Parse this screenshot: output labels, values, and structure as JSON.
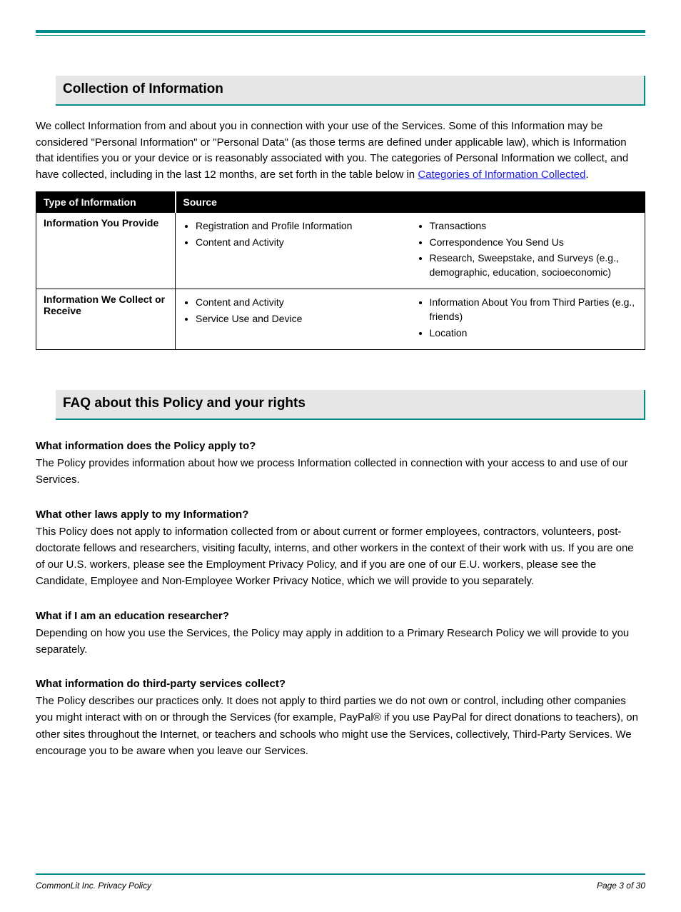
{
  "header_break_label": "Manual Header",
  "section1": {
    "title": "Collection of Information",
    "intro_prefix": "We collect Information from and about you in connection with your use of the Services. Some of this Information may be considered \"Personal Information\" or \"Personal Data\" (as those terms are defined under applicable law), which is Information that identifies you or your device or is reasonably associated with you. The categories of Personal Information we collect, and have collected, including in the last 12 months, are set forth in the table below in ",
    "intro_link": "Categories of Information Collected",
    "table": {
      "h1": "Type of Information",
      "h2": "Source",
      "rows": [
        {
          "category": "Information You Provide",
          "items_left": [
            "Registration and Profile Information",
            "Content and Activity"
          ],
          "items_right": [
            "Transactions",
            "Correspondence You Send Us",
            "Research, Sweepstake, and Surveys (e.g., demographic, education, socioeconomic)"
          ]
        },
        {
          "category": "Information We Collect or Receive",
          "items_left": [
            "Content and Activity",
            "Service Use and Device"
          ],
          "items_right": [
            "Information About You from Third Parties (e.g., friends)",
            "Location"
          ]
        }
      ]
    }
  },
  "section2": {
    "title": "FAQ about this Policy and your rights",
    "qa": [
      {
        "q": "What information does the Policy apply to?",
        "a": "The Policy provides information about how we process Information collected in connection with your access to and use of our Services."
      },
      {
        "q": "What other laws apply to my Information?",
        "a": "This Policy does not apply to information collected from or about current or former employees, contractors, volunteers, post-doctorate fellows and researchers, visiting faculty, interns, and other workers in the context of their work with us. If you are one of our U.S. workers, please see the Employment Privacy Policy, and if you are one of our E.U. workers, please see the Candidate, Employee and Non-Employee Worker Privacy Notice, which we will provide to you separately."
      },
      {
        "q": "What if I am an education researcher?",
        "a": "Depending on how you use the Services, the Policy may apply in addition to a Primary Research Policy we will provide to you separately."
      },
      {
        "q": "What information do third-party services collect?",
        "a": "The Policy describes our practices only. It does not apply to third parties we do not own or control, including other companies you might interact with on or through the Services (for example, PayPal® if you use PayPal for direct donations to teachers), on other sites throughout the Internet, or teachers and schools who might use the Services, collectively, Third-Party Services. We encourage you to be aware when you leave our Services."
      }
    ]
  },
  "footer": {
    "left": "CommonLit Inc. Privacy Policy",
    "right": "Page 3 of 30"
  }
}
